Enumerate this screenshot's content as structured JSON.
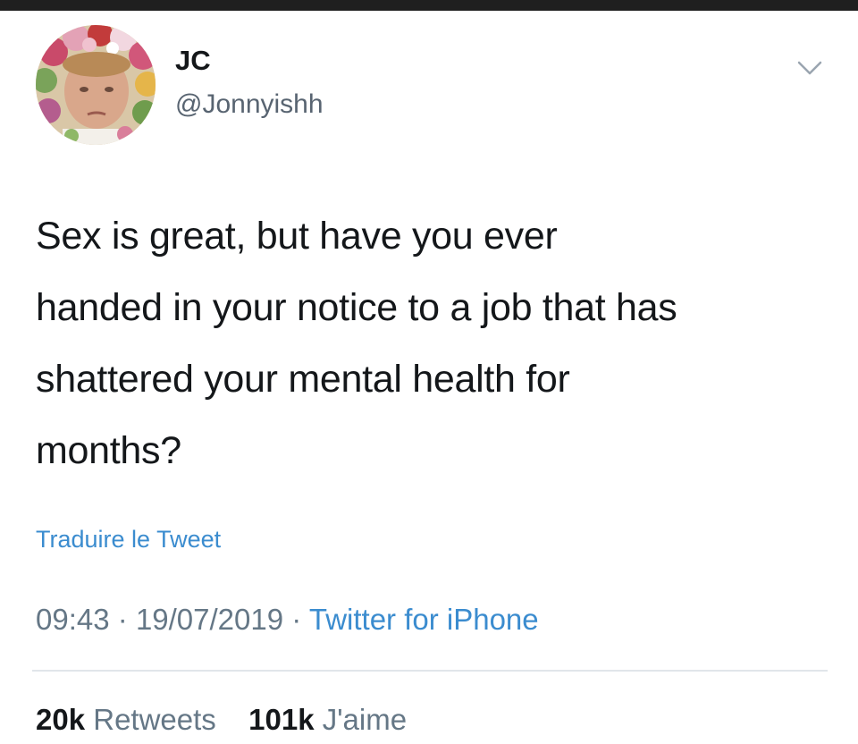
{
  "tweet": {
    "author": {
      "display_name": "JC",
      "handle": "@Jonnyishh"
    },
    "menu_icon": "chevron-down-icon",
    "text_lines": [
      "Sex is great, but have you ever",
      "handed in your notice to a job that has",
      "shattered your mental health for",
      "months?"
    ],
    "translate_label": "Traduire le Tweet",
    "time": "09:43",
    "separator": "·",
    "date": "19/07/2019",
    "source": "Twitter for iPhone",
    "stats": {
      "retweets_count": "20k",
      "retweets_label": "Retweets",
      "likes_count": "101k",
      "likes_label": "J'aime"
    }
  },
  "colors": {
    "text": "#14171a",
    "secondary": "#657786",
    "link": "#3b8ccf",
    "divider": "#e1e6ea",
    "top_bar": "#1f1f1f"
  }
}
